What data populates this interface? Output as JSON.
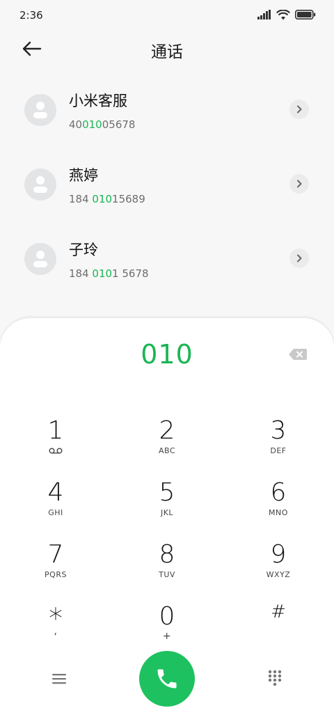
{
  "status_bar": {
    "time": "2:36",
    "icons": [
      "signal-icon",
      "wifi-icon",
      "battery-icon"
    ]
  },
  "header": {
    "back_icon": "back-arrow-icon",
    "title": "通话"
  },
  "contacts": [
    {
      "name": "小米客服",
      "number_prefix": "40",
      "number_match": "010",
      "number_suffix": "05678"
    },
    {
      "name": "燕婷",
      "number_prefix": "184 ",
      "number_match": "010",
      "number_suffix": "15689"
    },
    {
      "name": "子玲",
      "number_prefix": "184 ",
      "number_match": "010",
      "number_suffix": "1 5678"
    }
  ],
  "dialer": {
    "input": "010",
    "keys": [
      {
        "digit": "1",
        "letters": ""
      },
      {
        "digit": "2",
        "letters": "ABC"
      },
      {
        "digit": "3",
        "letters": "DEF"
      },
      {
        "digit": "4",
        "letters": "GHI"
      },
      {
        "digit": "5",
        "letters": "JKL"
      },
      {
        "digit": "6",
        "letters": "MNO"
      },
      {
        "digit": "7",
        "letters": "PQRS"
      },
      {
        "digit": "8",
        "letters": "TUV"
      },
      {
        "digit": "9",
        "letters": "WXYZ"
      },
      {
        "digit": "*",
        "letters": ","
      },
      {
        "digit": "0",
        "letters": "+"
      },
      {
        "digit": "#",
        "letters": ""
      }
    ]
  },
  "colors": {
    "accent": "#1bb554",
    "call_button": "#1ec15f",
    "sheet_bg": "#ffffff",
    "page_bg": "#f7f7f7"
  }
}
